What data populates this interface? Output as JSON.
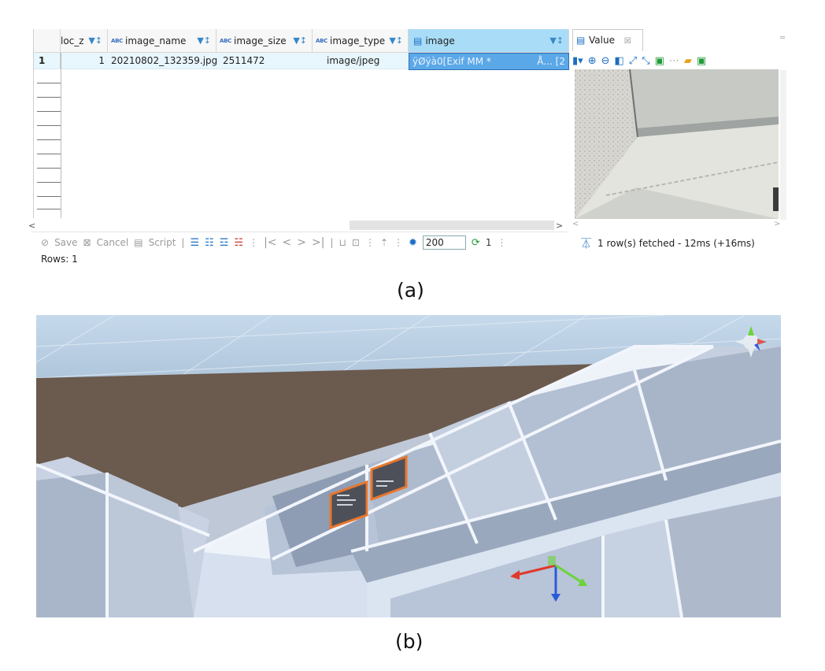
{
  "grid": {
    "columns": [
      {
        "label": "loc_z",
        "type_badge": ""
      },
      {
        "label": "image_name",
        "type_badge": "ABC"
      },
      {
        "label": "image_size",
        "type_badge": "ABC"
      },
      {
        "label": "image_type",
        "type_badge": "ABC"
      },
      {
        "label": "image",
        "type_badge": ""
      }
    ],
    "row": {
      "number": "1",
      "loc_z": "1",
      "image_name": "20210802_132359.jpg",
      "image_size": "2511472",
      "image_type": "image/jpeg",
      "image": "ÿØÿà0[Exif  MM *",
      "image_tail": "Å... [2"
    }
  },
  "value_panel": {
    "tab_label": "Value",
    "tab_close": "☒"
  },
  "footer": {
    "save_label": "Save",
    "cancel_label": "Cancel",
    "script_label": "Script",
    "fetch_size": "200",
    "refresh_count": "1",
    "status": "1 row(s) fetched - 12ms (+16ms)",
    "rows_label": "Rows: 1"
  },
  "captions": {
    "a": "(a)",
    "b": "(b)"
  },
  "colors": {
    "selected_cell": "#5ba8e8",
    "row_highlight": "#e8f6fd",
    "accent": "#1b6ec2",
    "floor": "#6b5a4e",
    "walls": "#c9d2e3",
    "frame_orange": "#e8772e"
  },
  "icons": [
    "filter-icon",
    "image-column-icon",
    "value-panel-icon",
    "zoom-in-icon",
    "zoom-out-icon",
    "save-icon",
    "first-page-icon",
    "prev-page-icon",
    "next-page-icon",
    "last-page-icon",
    "settings-icon",
    "refresh-icon",
    "status-icon",
    "gizmo-axis-icon"
  ]
}
